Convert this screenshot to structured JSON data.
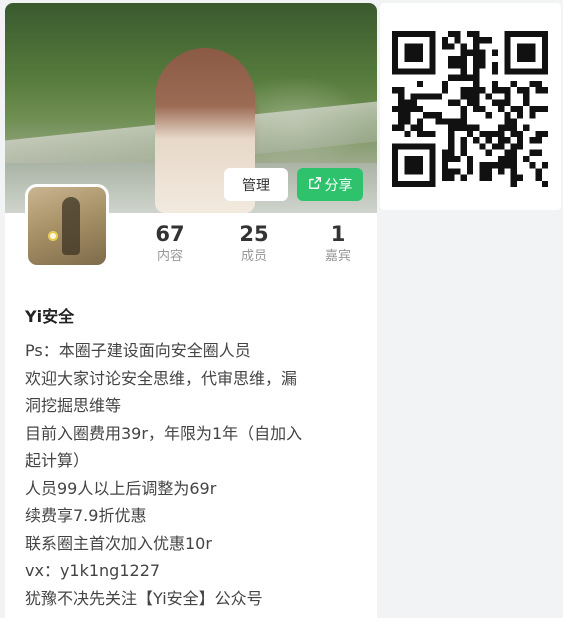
{
  "cover": {
    "icon": "cover-photo"
  },
  "buttons": {
    "manage_label": "管理",
    "share_label": "分享"
  },
  "stats": [
    {
      "num": "67",
      "label": "内容"
    },
    {
      "num": "25",
      "label": "成员"
    },
    {
      "num": "1",
      "label": "嘉宾"
    }
  ],
  "circle": {
    "name": "Yi安全",
    "description": [
      "Ps：本圈子建设面向安全圈人员",
      "欢迎大家讨论安全思维，代审思维，漏",
      "洞挖掘思维等",
      "目前入圈费用39r，年限为1年（自加入",
      "起计算）",
      "人员99人以上后调整为69r",
      "续费享7.9折优惠",
      "联系圈主首次加入优惠10r",
      "vx：y1k1ng1227",
      "犹豫不决先关注【Yi安全】公众号"
    ]
  },
  "colors": {
    "accent": "#2dc26b",
    "text": "#444444",
    "muted": "#999999"
  }
}
